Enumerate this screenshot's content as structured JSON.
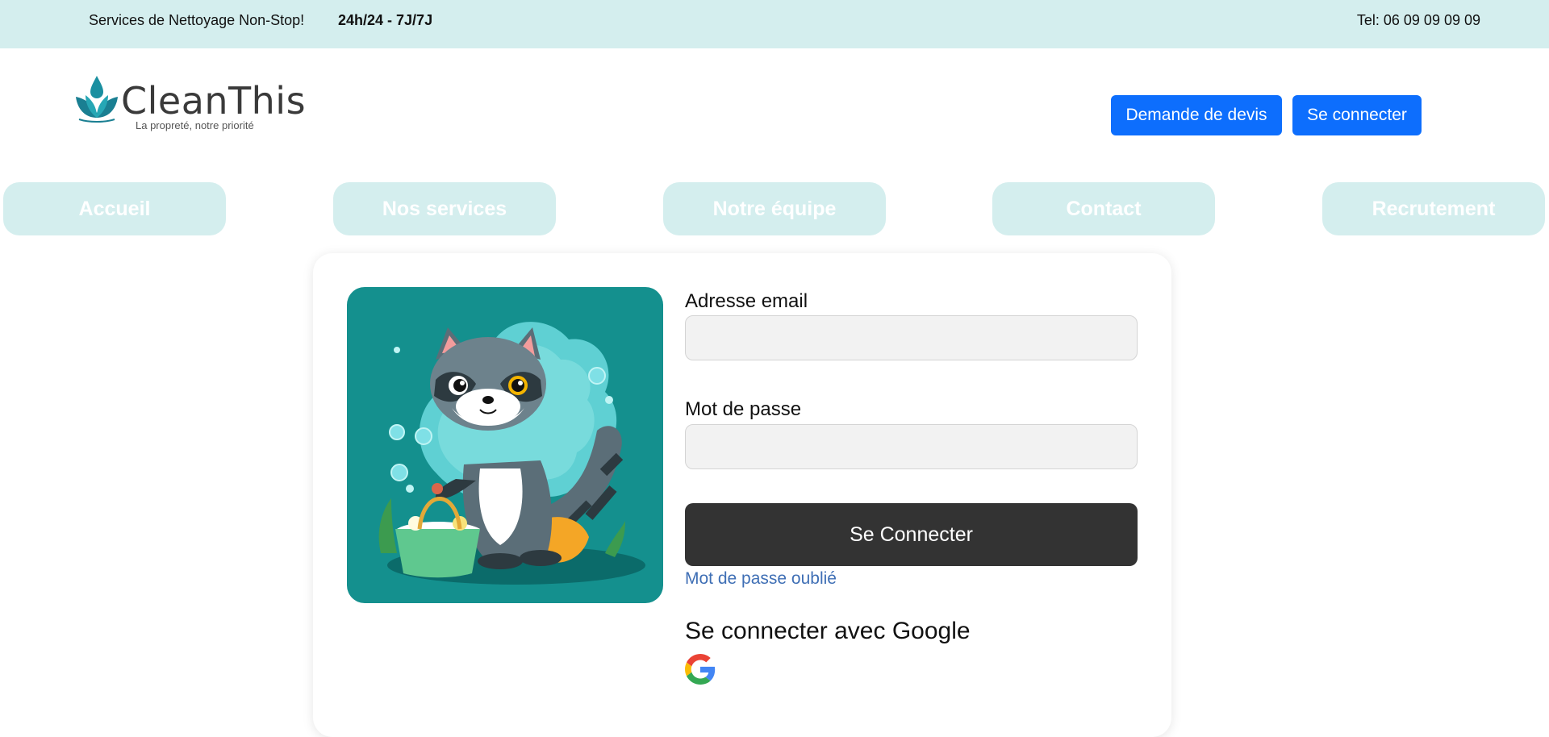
{
  "topbar": {
    "tagline": "Services de Nettoyage Non-Stop!",
    "hours": "24h/24 - 7J/7J",
    "phone": "Tel: 06 09 09 09 09"
  },
  "logo": {
    "name": "CleanThis",
    "slogan": "La propreté, notre priorité"
  },
  "header": {
    "quote_button": "Demande de devis",
    "login_button": "Se connecter"
  },
  "nav": {
    "items": [
      {
        "label": "Accueil"
      },
      {
        "label": "Nos services"
      },
      {
        "label": "Notre équipe"
      },
      {
        "label": "Contact"
      },
      {
        "label": "Recrutement"
      }
    ]
  },
  "login_form": {
    "email_label": "Adresse email",
    "email_value": "",
    "password_label": "Mot de passe",
    "password_value": "",
    "submit_label": "Se Connecter",
    "forgot_link": "Mot de passe oublié",
    "google_title": "Se connecter avec Google"
  },
  "colors": {
    "topbar_bg": "#d4eeee",
    "primary_button": "#0d6efd",
    "submit_button": "#333333",
    "link": "#3f6fb5",
    "illustration_bg": "#14908e"
  },
  "icons": {
    "logo": "water-drop-leaf-icon",
    "google": "google-g-icon",
    "illustration": "raccoon-cleaning-illustration"
  }
}
